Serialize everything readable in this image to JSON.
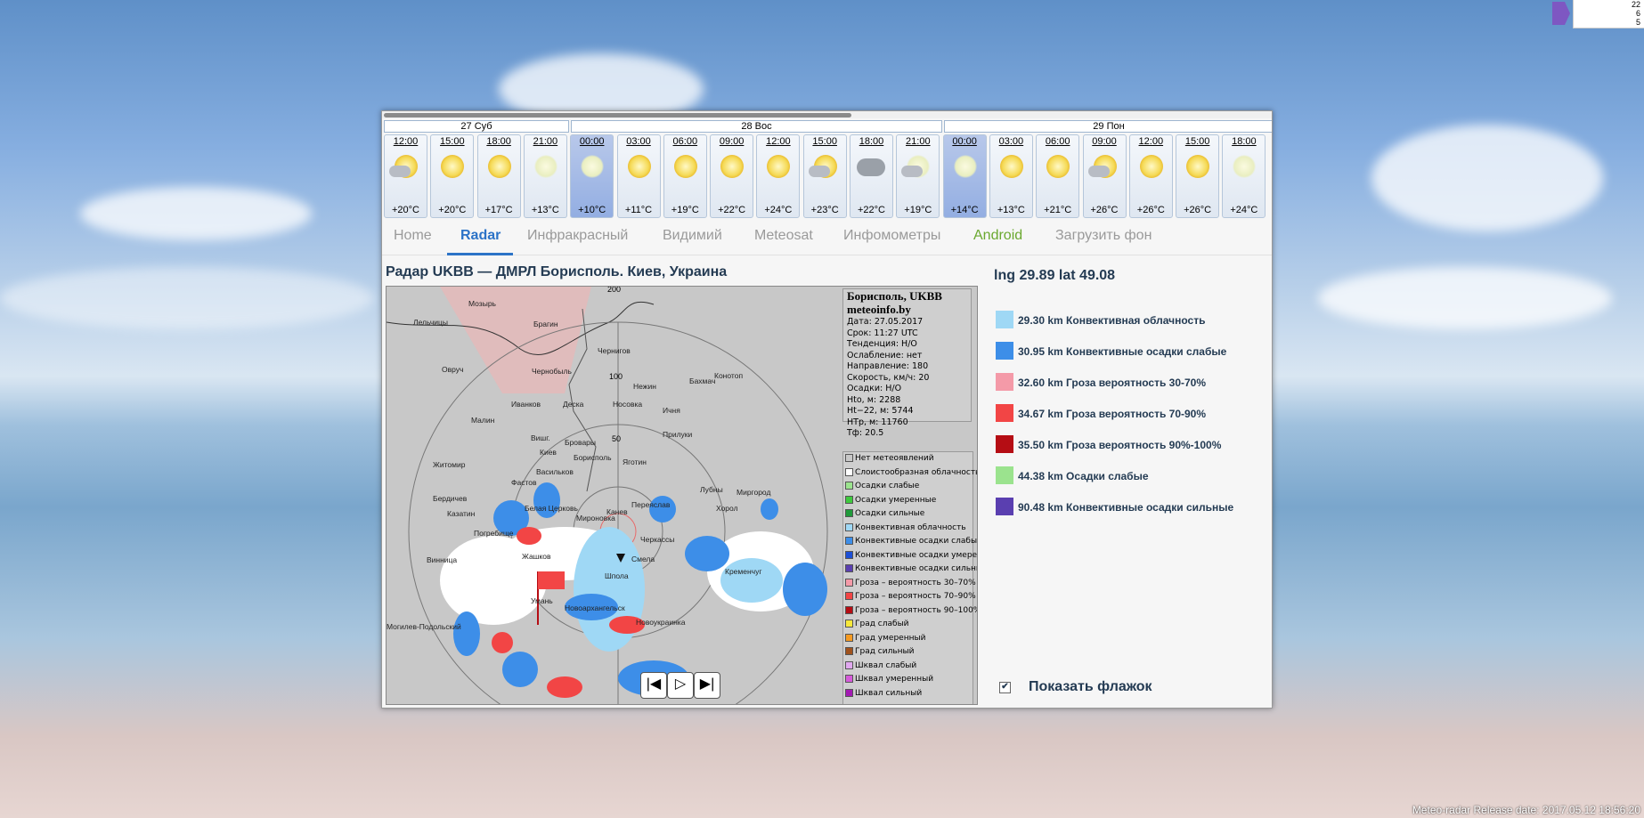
{
  "desktop": {
    "release_text": "Meteo-radar Release date: 2017.05.12 18:56:20",
    "tray_lines": [
      "22",
      "6",
      "5"
    ]
  },
  "forecast": {
    "days": [
      {
        "label": "27 Суб"
      },
      {
        "label": "28 Вос"
      },
      {
        "label": "29 Пон"
      }
    ],
    "hours": [
      {
        "time": "12:00",
        "temp": "+20°C",
        "icon": "sun-cloud-icon",
        "night": false
      },
      {
        "time": "15:00",
        "temp": "+20°C",
        "icon": "sun-icon",
        "night": false
      },
      {
        "time": "18:00",
        "temp": "+17°C",
        "icon": "sun-icon",
        "night": false
      },
      {
        "time": "21:00",
        "temp": "+13°C",
        "icon": "moon-icon",
        "night": false
      },
      {
        "time": "00:00",
        "temp": "+10°C",
        "icon": "moon-icon",
        "night": true
      },
      {
        "time": "03:00",
        "temp": "+11°C",
        "icon": "sun-icon",
        "night": false
      },
      {
        "time": "06:00",
        "temp": "+19°C",
        "icon": "sun-icon",
        "night": false
      },
      {
        "time": "09:00",
        "temp": "+22°C",
        "icon": "sun-icon",
        "night": false
      },
      {
        "time": "12:00",
        "temp": "+24°C",
        "icon": "sun-icon",
        "night": false
      },
      {
        "time": "15:00",
        "temp": "+23°C",
        "icon": "sun-cloud-icon",
        "night": false
      },
      {
        "time": "18:00",
        "temp": "+22°C",
        "icon": "overcast-icon",
        "night": false
      },
      {
        "time": "21:00",
        "temp": "+19°C",
        "icon": "moon-cloud-icon",
        "night": false
      },
      {
        "time": "00:00",
        "temp": "+14°C",
        "icon": "moon-icon",
        "night": true
      },
      {
        "time": "03:00",
        "temp": "+13°C",
        "icon": "sun-icon",
        "night": false
      },
      {
        "time": "06:00",
        "temp": "+21°C",
        "icon": "sun-icon",
        "night": false
      },
      {
        "time": "09:00",
        "temp": "+26°C",
        "icon": "sun-cloud-icon",
        "night": false
      },
      {
        "time": "12:00",
        "temp": "+26°C",
        "icon": "sun-icon",
        "night": false
      },
      {
        "time": "15:00",
        "temp": "+26°C",
        "icon": "sun-icon",
        "night": false
      },
      {
        "time": "18:00",
        "temp": "+24°C",
        "icon": "moon-icon",
        "night": false
      }
    ]
  },
  "tabs": [
    {
      "label": "Home",
      "name": "tab-home"
    },
    {
      "label": "Radar",
      "name": "tab-radar"
    },
    {
      "label": "Инфракрасный",
      "name": "tab-infrared"
    },
    {
      "label": "Видимий",
      "name": "tab-visible"
    },
    {
      "label": "Meteosat",
      "name": "tab-meteosat"
    },
    {
      "label": "Инфомометры",
      "name": "tab-infometers"
    },
    {
      "label": "Android",
      "name": "tab-android"
    },
    {
      "label": "Загрузить фон",
      "name": "tab-upload-background"
    }
  ],
  "radar": {
    "title": "Радар UKBB — ДМРЛ Борисполь. Киев, Украина",
    "info": {
      "station": "Борисполь, UKBB",
      "site": "meteoinfo.by",
      "lines": [
        "Дата: 27.05.2017",
        "Срок: 11:27 UTC",
        "Тенденция: Н/О",
        "Ослабление: нет",
        "Направление: 180",
        "Скорость, км/ч: 20",
        "Осадки: Н/О",
        "Нto, м: 2288",
        "Нt−22, м: 5744",
        "НТр, м: 11760",
        "Тф: 20.5"
      ]
    },
    "legend": [
      {
        "label": "Нет метеоявлений",
        "color": "#c8c8c8"
      },
      {
        "label": "Слоистообразная облачность",
        "color": "#ffffff"
      },
      {
        "label": "Осадки слабые",
        "color": "#9be38e"
      },
      {
        "label": "Осадки умеренные",
        "color": "#3ec93e"
      },
      {
        "label": "Осадки сильные",
        "color": "#1f9a3a"
      },
      {
        "label": "Конвективная облачность",
        "color": "#9fd8f5"
      },
      {
        "label": "Конвективные осадки слабые",
        "color": "#3d8ee8"
      },
      {
        "label": "Конвективные осадки умерен.",
        "color": "#1c4fd6"
      },
      {
        "label": "Конвективные осадки сильные",
        "color": "#5a3fb0"
      },
      {
        "label": "Гроза – вероятность 30–70%",
        "color": "#f49aa8"
      },
      {
        "label": "Гроза – вероятность 70–90%",
        "color": "#f24545"
      },
      {
        "label": "Гроза – вероятность 90–100%",
        "color": "#b50d14"
      },
      {
        "label": "Град слабый",
        "color": "#f7e83a"
      },
      {
        "label": "Град умеренный",
        "color": "#f59a21"
      },
      {
        "label": "Град сильный",
        "color": "#a0521d"
      },
      {
        "label": "Шквал слабый",
        "color": "#e0a8ef"
      },
      {
        "label": "Шквал умеренный",
        "color": "#d55bd9"
      },
      {
        "label": "Шквал сильный",
        "color": "#a31ab3"
      }
    ],
    "ring_labels": [
      "50",
      "100",
      "200"
    ],
    "cities": [
      "Мозырь",
      "Лельчицы",
      "Брагин",
      "Чернигов",
      "Овруч",
      "Чернобыль",
      "Бахмач",
      "Конотоп",
      "Нежин",
      "Иванков",
      "Деска",
      "Носовка",
      "Ичня",
      "Малин",
      "Вишг.",
      "Бровары",
      "Прилуки",
      "Житомир",
      "Киев",
      "Борисполь",
      "Яготин",
      "Васильков",
      "Фастов",
      "Лубны",
      "Миргород",
      "Бердичев",
      "Белая Церковь",
      "Казатин",
      "Переяслав",
      "Канев",
      "Хорол",
      "Погребище",
      "Мироновка",
      "Черкассы",
      "Винница",
      "Жашков",
      "Смела",
      "Кременчуг",
      "Шпола",
      "Умань",
      "Новоархангельск",
      "Могилев-Подольский",
      "Новоукраинка"
    ],
    "controls": {
      "first": "|◀",
      "play": "▷",
      "last": "▶|"
    }
  },
  "side": {
    "coords": "lng 29.89 lat 49.08",
    "legend": [
      {
        "label": "29.30 km Конвективная облачность",
        "color": "#9fd8f5"
      },
      {
        "label": "30.95 km Конвективные осадки слабые",
        "color": "#3d8ee8"
      },
      {
        "label": "32.60 km Гроза вероятность 30-70%",
        "color": "#f49aa8"
      },
      {
        "label": "34.67 km Гроза вероятность 70-90%",
        "color": "#f24545"
      },
      {
        "label": "35.50 km Гроза вероятность 90%-100%",
        "color": "#b50d14"
      },
      {
        "label": "44.38 km Осадки слабые",
        "color": "#9be38e"
      },
      {
        "label": "90.48 km Конвективные осадки сильные",
        "color": "#5a3fb0"
      }
    ],
    "show_flag_label": "Показать флажок",
    "show_flag_checked": true
  }
}
